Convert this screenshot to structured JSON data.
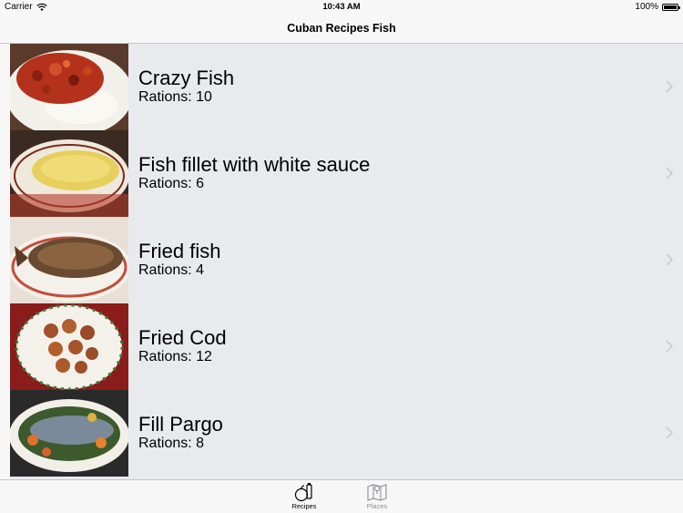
{
  "status_bar": {
    "carrier": "Carrier",
    "time": "10:43 AM",
    "battery": "100%"
  },
  "nav": {
    "title": "Cuban Recipes Fish"
  },
  "recipes": [
    {
      "name": "Crazy Fish",
      "rations": "Rations: 10"
    },
    {
      "name": "Fish fillet with white sauce",
      "rations": "Rations: 6"
    },
    {
      "name": "Fried fish",
      "rations": "Rations: 4"
    },
    {
      "name": "Fried Cod",
      "rations": "Rations: 12"
    },
    {
      "name": "Fill Pargo",
      "rations": "Rations: 8"
    }
  ],
  "tabs": [
    {
      "label": "Recipes",
      "icon": "recipes-icon",
      "selected": true
    },
    {
      "label": "Places",
      "icon": "map-icon",
      "selected": false
    }
  ],
  "colors": {
    "list_background": "#e8eaed",
    "bar_background": "#f7f7f7",
    "inactive_tab": "#8e8e93"
  }
}
